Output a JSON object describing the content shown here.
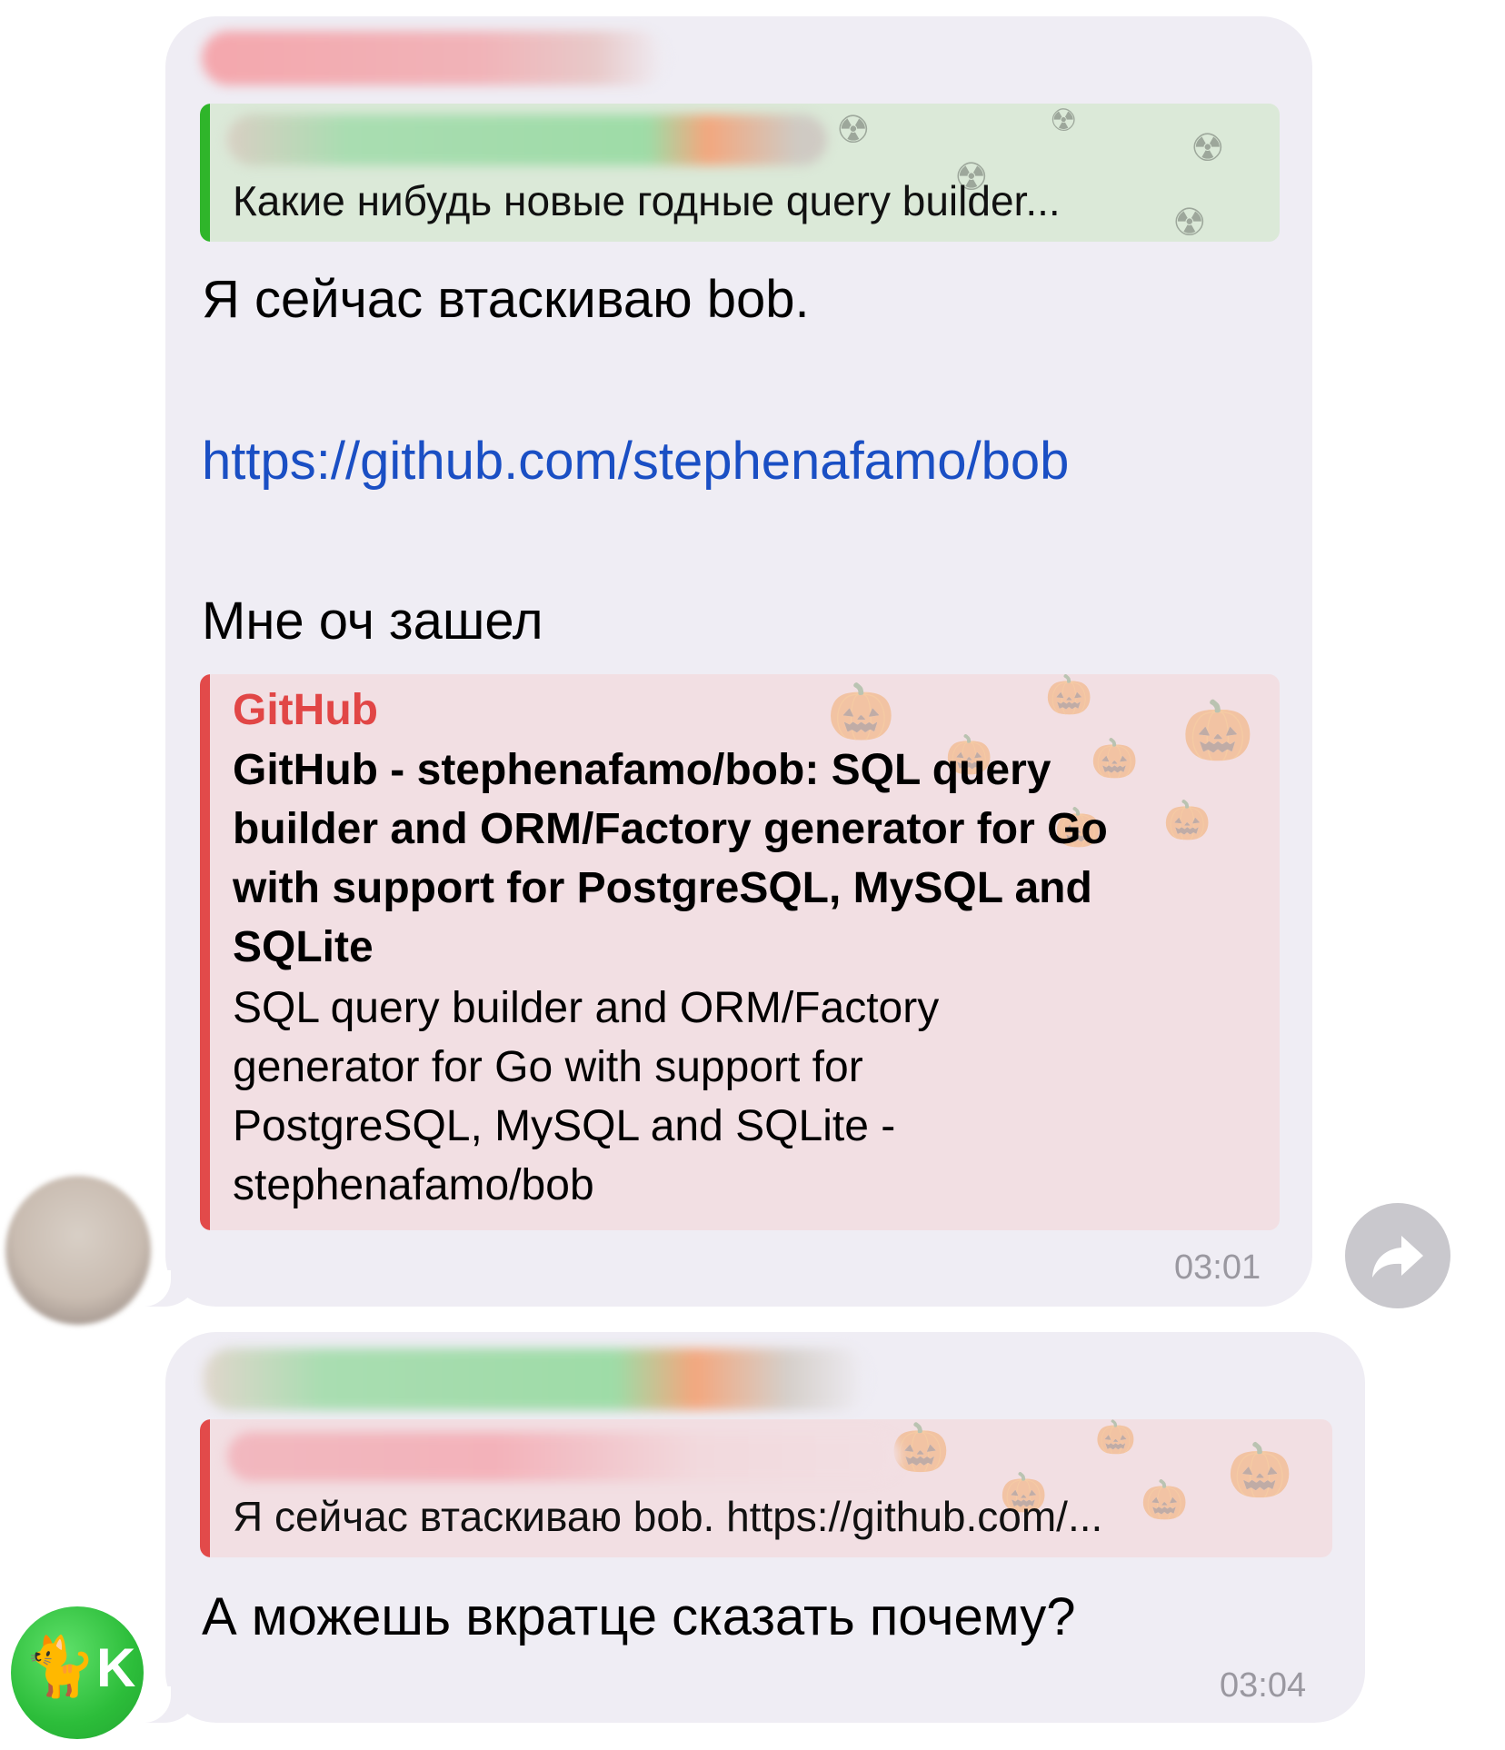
{
  "messages": [
    {
      "reply_quote_text": "Какие нибудь новые годные query builder...",
      "line1": "Я сейчас втаскиваю bob.",
      "link": "https://github.com/stephenafamo/bob",
      "line2": "Мне оч зашел",
      "preview": {
        "site": "GitHub",
        "title_lines": [
          "GitHub - stephenafamo/bob: SQL query",
          "builder and ORM/Factory generator for Go",
          "with support for PostgreSQL, MySQL and",
          "SQLite"
        ],
        "desc_lines": [
          "SQL query builder and ORM/Factory",
          "generator for Go with support for",
          "PostgreSQL, MySQL and SQLite -",
          "stephenafamo/bob"
        ]
      },
      "time": "03:01"
    },
    {
      "reply_quote_text": "Я сейчас втаскиваю bob. https://github.com/...",
      "text": "А можешь вкратце сказать почему?",
      "time": "03:04"
    }
  ],
  "avatar2": {
    "emoji": "🐈",
    "letter": "K"
  },
  "colors": {
    "link": "#1a4fc4",
    "github_accent": "#e14646",
    "green_quote_bar": "#2fb52a",
    "red_quote_bar": "#e24a4a",
    "bubble_bg": "#efedf4",
    "time": "#9a98a0"
  },
  "icons": {
    "forward": "forward-arrow-icon",
    "pattern_green": "gas-mask-icon",
    "pattern_red": "pumpkin-icon"
  }
}
